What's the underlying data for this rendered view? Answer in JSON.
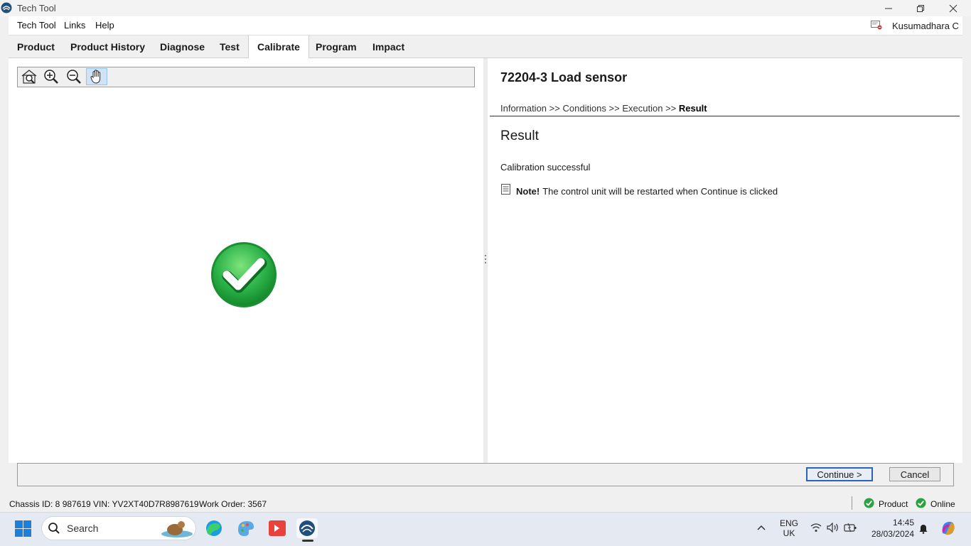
{
  "window": {
    "title": "Tech Tool"
  },
  "menu": {
    "items": [
      "Tech Tool",
      "Links",
      "Help"
    ],
    "user": "Kusumadhara C"
  },
  "tabs": [
    "Product",
    "Product History",
    "Diagnose",
    "Test",
    "Calibrate",
    "Program",
    "Impact"
  ],
  "active_tab": "Calibrate",
  "viewer_tools": [
    "zoom-fit-icon",
    "zoom-in-icon",
    "zoom-out-icon",
    "pan-hand-icon"
  ],
  "procedure": {
    "title": "72204-3 Load sensor",
    "steps": [
      "Information",
      "Conditions",
      "Execution",
      "Result"
    ],
    "separator": ">>",
    "current_step": "Result",
    "heading": "Result",
    "result_text": "Calibration successful",
    "note_label": "Note!",
    "note_text": "The control unit will be restarted when Continue is clicked"
  },
  "buttons": {
    "continue": "Continue >",
    "cancel": "Cancel"
  },
  "status": {
    "chassis": "Chassis ID: 8 987619",
    "vin": "VIN: YV2XT40D7R8987619",
    "work_order": "Work Order: 3567",
    "product": "Product",
    "online": "Online"
  },
  "taskbar": {
    "search": "Search",
    "lang_top": "ENG",
    "lang_bottom": "UK",
    "time": "14:45",
    "date": "28/03/2024"
  },
  "colors": {
    "success_green": "#2db34a",
    "accent_blue": "#2a64b8",
    "status_ok": "#2ea043"
  }
}
